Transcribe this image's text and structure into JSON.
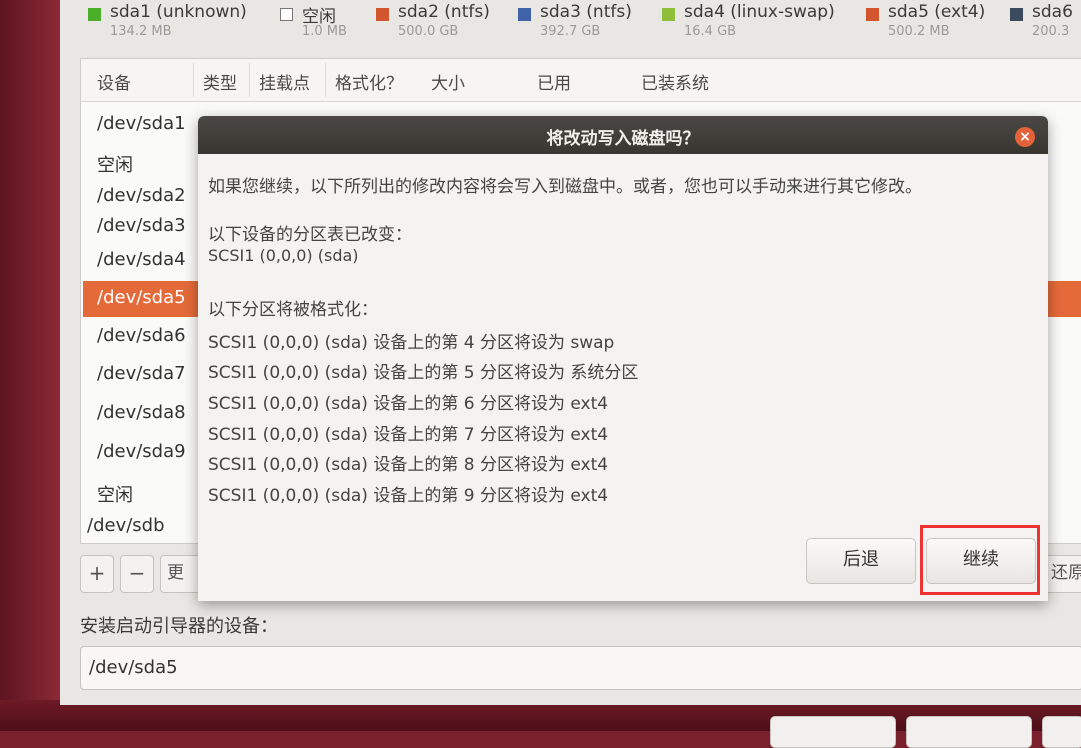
{
  "legend": [
    {
      "label": "sda1 (unknown)",
      "size": "134.2 MB",
      "color": "#4caf2a"
    },
    {
      "label": "空闲",
      "size": "1.0 MB",
      "color": "#ffffff"
    },
    {
      "label": "sda2 (ntfs)",
      "size": "500.0 GB",
      "color": "#d2552e"
    },
    {
      "label": "sda3 (ntfs)",
      "size": "392.7 GB",
      "color": "#3e63a8"
    },
    {
      "label": "sda4 (linux-swap)",
      "size": "16.4 GB",
      "color": "#8fbe3a"
    },
    {
      "label": "sda5 (ext4)",
      "size": "500.2 MB",
      "color": "#d2552e"
    },
    {
      "label": "sda6",
      "size": "200.3",
      "color": "#3c4a5e"
    }
  ],
  "table": {
    "columns": [
      "设备",
      "类型",
      "挂载点",
      "格式化？",
      "大小",
      "已用",
      "已装系统"
    ],
    "rows": [
      "/dev/sda1",
      "空闲",
      "/dev/sda2",
      "/dev/sda3",
      "/dev/sda4",
      "/dev/sda5",
      "/dev/sda6",
      "/dev/sda7",
      "/dev/sda8",
      "/dev/sda9",
      "空闲",
      "/dev/sdb"
    ],
    "selected_row": "/dev/sda5"
  },
  "toolbar": {
    "add": "+",
    "remove": "−",
    "change": "更改…",
    "revert": "还原分区表"
  },
  "boot": {
    "label": "安装启动引导器的设备：",
    "value": "/dev/sda5"
  },
  "dialog": {
    "title": "将改动写入磁盘吗？",
    "intro": "如果您继续，以下所列出的修改内容将会写入到磁盘中。或者，您也可以手动来进行其它修改。",
    "partition_table_heading": "以下设备的分区表已改变：",
    "changed_device": "SCSI1 (0,0,0) (sda)",
    "format_heading": "以下分区将被格式化：",
    "format_items": [
      "SCSI1 (0,0,0) (sda) 设备上的第 4 分区将设为 swap",
      "SCSI1 (0,0,0) (sda) 设备上的第 5 分区将设为 系统分区",
      "SCSI1 (0,0,0) (sda) 设备上的第 6 分区将设为 ext4",
      "SCSI1 (0,0,0) (sda) 设备上的第 7 分区将设为 ext4",
      "SCSI1 (0,0,0) (sda) 设备上的第 8 分区将设为 ext4",
      "SCSI1 (0,0,0) (sda) 设备上的第 9 分区将设为 ext4"
    ],
    "back_label": "后退",
    "continue_label": "继续"
  },
  "colors": {
    "accent": "#e46a3a",
    "highlight_box": "#ef3333",
    "titlebar": "#3c3b37"
  }
}
